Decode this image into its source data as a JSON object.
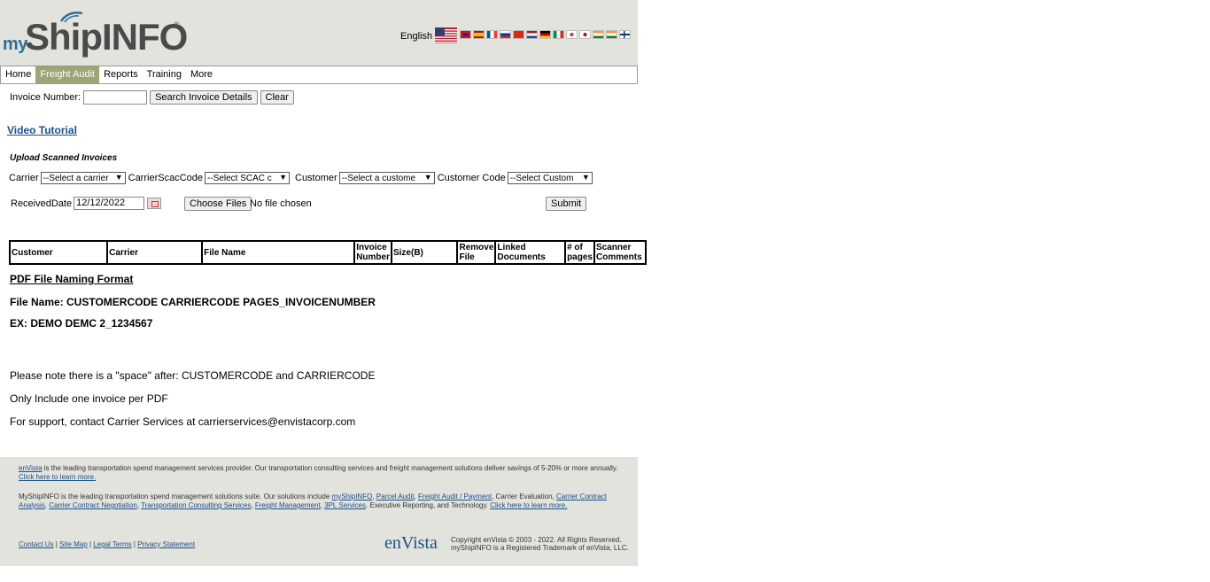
{
  "header": {
    "logo_my": "my",
    "logo_ship": "ShipINFO",
    "logo_reg": "®",
    "language": "English",
    "flags": [
      "gb",
      "es",
      "fr",
      "ru",
      "cn",
      "nl",
      "de",
      "it",
      "kr",
      "jp",
      "in",
      "in2",
      "fi"
    ]
  },
  "nav": {
    "items": [
      "Home",
      "Freight Audit",
      "Reports",
      "Training",
      "More"
    ],
    "active": "Freight Audit"
  },
  "search": {
    "label": "Invoice Number:",
    "value": "",
    "search_button": "Search Invoice Details",
    "clear_button": "Clear"
  },
  "video_link": "Video Tutorial",
  "upload": {
    "title": "Upload Scanned Invoices",
    "carrier_label": "Carrier",
    "carrier_value": "--Select a carrier",
    "scac_label": "CarrierScacCode",
    "scac_value": "--Select SCAC c",
    "customer_label": "Customer",
    "customer_value": "--Select a custome",
    "customer_code_label": "Customer Code",
    "customer_code_value": "--Select Custom",
    "received_label": "ReceivedDate",
    "received_value": "12/12/2022",
    "choose_button": "Choose Files",
    "no_file": "No file chosen",
    "submit_button": "Submit"
  },
  "table": {
    "headers": [
      "Customer",
      "Carrier",
      "File Name",
      "Invoice Number",
      "Size(B)",
      "Remove File",
      "Linked Documents",
      "# of pages",
      "Scanner Comments"
    ]
  },
  "notes": {
    "title": "PDF File Naming Format",
    "file_name": "File Name: CUSTOMERCODE CARRIERCODE PAGES_INVOICENUMBER",
    "example": "EX: DEMO DEMC 2_1234567",
    "space_note": "Please note there is a \"space\" after: CUSTOMERCODE and CARRIERCODE",
    "one_invoice": "Only Include one invoice per PDF",
    "support": "For support, contact Carrier Services at carrierservices@envistacorp.com"
  },
  "footer": {
    "p1_link": "enVista",
    "p1_text": " is the leading transportation spend management services provider. Our transportation consulting services and freight management solutions deliver savings of 5-20% or more annually. ",
    "p1_learn": "Click here to learn more.",
    "p2_text": "MyShipINFO is the leading transportation spend management solutions suite. Our solutions include ",
    "p2_links": [
      "myShipINFO",
      "Parcel Audit",
      "Freight Audit / Payment"
    ],
    "p2_mid": ", Carrier Evaluation, ",
    "p2_links2": [
      "Carrier Contract Analysis",
      "Carrier Contract Negotiation",
      "Transportation Consulting Services",
      "Freight Management",
      "3PL Services"
    ],
    "p2_end": ". Executive Reporting, and Technology. ",
    "p2_learn": "Click here to learn more.",
    "links": [
      "Contact Us",
      "Site Map",
      "Legal Terms",
      "Privacy Statement"
    ],
    "brand": "enVista",
    "copyright1": "Copyright enVista © 2003 - 2022. All Rights Reserved.",
    "copyright2": "myShipINFO is a Registered Trademark of enVista, LLC."
  }
}
